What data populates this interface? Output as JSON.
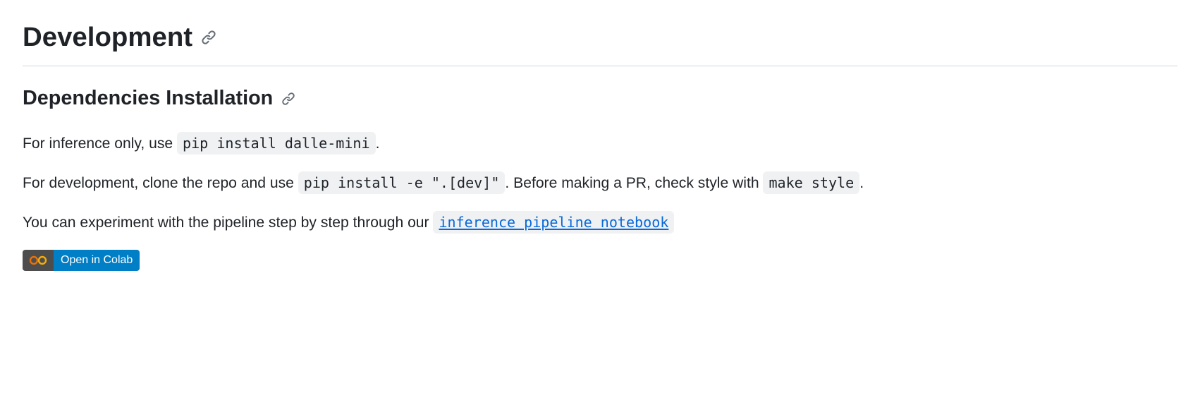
{
  "headings": {
    "h1": "Development",
    "h2": "Dependencies Installation"
  },
  "para1": {
    "pre": "For inference only, use ",
    "code": "pip install dalle-mini",
    "post": "."
  },
  "para2": {
    "pre": "For development, clone the repo and use ",
    "code1": "pip install -e \".[dev]\"",
    "mid": ". Before making a PR, check style with ",
    "code2": "make style",
    "post": "."
  },
  "para3": {
    "pre": "You can experiment with the pipeline step by step through our ",
    "link_text": "inference pipeline notebook"
  },
  "badge": {
    "label": "Open in Colab"
  }
}
